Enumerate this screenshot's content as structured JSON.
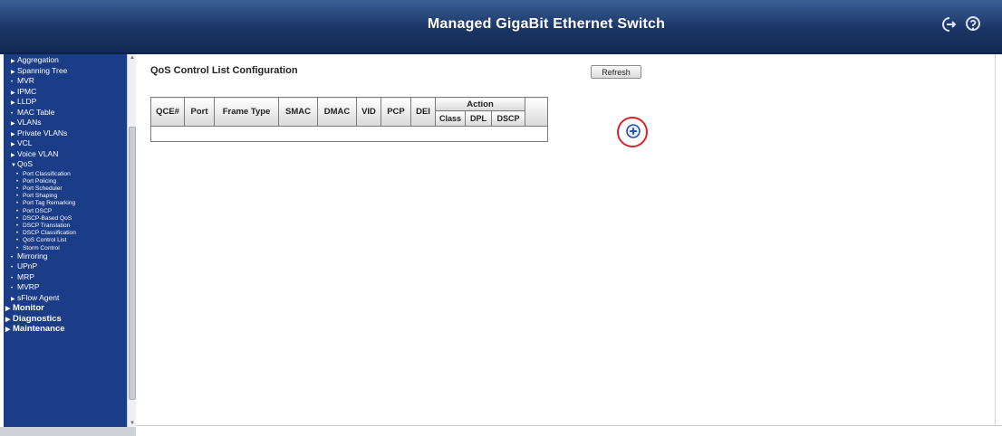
{
  "header": {
    "title": "Managed GigaBit Ethernet Switch",
    "logout_icon": "logout-icon",
    "help_icon": "help-icon"
  },
  "sidebar": {
    "items": [
      {
        "label": "Aggregation",
        "marker": "▶",
        "level": 1
      },
      {
        "label": "Spanning Tree",
        "marker": "▶",
        "level": 1
      },
      {
        "label": "MVR",
        "marker": "•",
        "level": 1
      },
      {
        "label": "IPMC",
        "marker": "▶",
        "level": 1
      },
      {
        "label": "LLDP",
        "marker": "▶",
        "level": 1
      },
      {
        "label": "MAC Table",
        "marker": "•",
        "level": 1
      },
      {
        "label": "VLANs",
        "marker": "▶",
        "level": 1
      },
      {
        "label": "Private VLANs",
        "marker": "▶",
        "level": 1
      },
      {
        "label": "VCL",
        "marker": "▶",
        "level": 1
      },
      {
        "label": "Voice VLAN",
        "marker": "▶",
        "level": 1
      },
      {
        "label": "QoS",
        "marker": "▼",
        "level": 1
      },
      {
        "label": "Port Classification",
        "marker": "•",
        "level": 2
      },
      {
        "label": "Port Policing",
        "marker": "•",
        "level": 2
      },
      {
        "label": "Port Scheduler",
        "marker": "•",
        "level": 2
      },
      {
        "label": "Port Shaping",
        "marker": "•",
        "level": 2
      },
      {
        "label": "Port Tag Remarking",
        "marker": "•",
        "level": 2
      },
      {
        "label": "Port DSCP",
        "marker": "•",
        "level": 2
      },
      {
        "label": "DSCP-Based QoS",
        "marker": "•",
        "level": 2
      },
      {
        "label": "DSCP Translation",
        "marker": "•",
        "level": 2
      },
      {
        "label": "DSCP Classification",
        "marker": "•",
        "level": 2
      },
      {
        "label": "QoS Control List",
        "marker": "•",
        "level": 2
      },
      {
        "label": "Storm Control",
        "marker": "•",
        "level": 2
      },
      {
        "label": "Mirroring",
        "marker": "•",
        "level": 1
      },
      {
        "label": "UPnP",
        "marker": "•",
        "level": 1
      },
      {
        "label": "MRP",
        "marker": "•",
        "level": 1
      },
      {
        "label": "MVRP",
        "marker": "•",
        "level": 1
      },
      {
        "label": "sFlow Agent",
        "marker": "▶",
        "level": 1
      },
      {
        "label": "Monitor",
        "marker": "▶",
        "level": 0
      },
      {
        "label": "Diagnostics",
        "marker": "▶",
        "level": 0
      },
      {
        "label": "Maintenance",
        "marker": "▶",
        "level": 0
      }
    ]
  },
  "main": {
    "title": "QoS Control List Configuration",
    "refresh_label": "Refresh",
    "table": {
      "headers": {
        "qce": "QCE#",
        "port": "Port",
        "frame_type": "Frame Type",
        "smac": "SMAC",
        "dmac": "DMAC",
        "vid": "VID",
        "pcp": "PCP",
        "dei": "DEI",
        "action": "Action",
        "class": "Class",
        "dpl": "DPL",
        "dscp": "DSCP"
      },
      "rows": []
    },
    "add_icon": "plus-circle-icon",
    "highlight_color": "#d8232a"
  },
  "colors": {
    "header_bg": "#1b3565",
    "sidebar_bg": "#1b3c87"
  }
}
